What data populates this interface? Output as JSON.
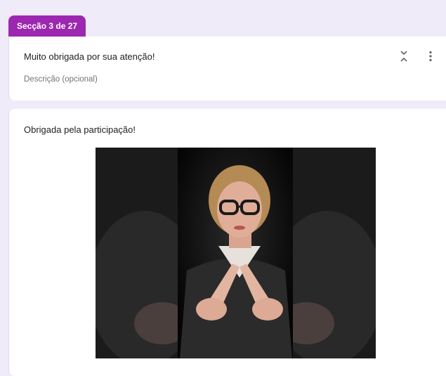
{
  "section_tab": {
    "label": "Secção 3 de 27"
  },
  "header": {
    "title": "Muito obrigada por sua atenção!",
    "description_placeholder": "Descrição (opcional)"
  },
  "content": {
    "title": "Obrigada pela participação!"
  },
  "icons": {
    "collapse": "collapse-vertical-icon",
    "more": "more-vert-icon"
  },
  "colors": {
    "accent": "#9c27b0",
    "background": "#f0ebf8",
    "card": "#ffffff"
  }
}
